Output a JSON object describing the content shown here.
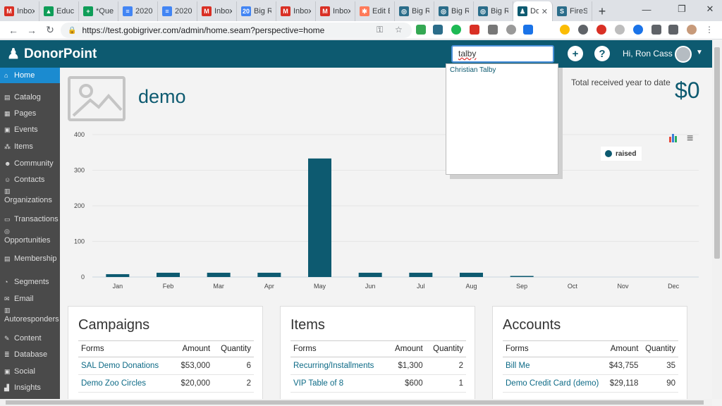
{
  "browser": {
    "tabs": [
      {
        "label": "Inbox",
        "icon": "gmail-icon",
        "color": "#d93025",
        "glyph": "M"
      },
      {
        "label": "Educa",
        "icon": "drive-icon",
        "color": "#0f9d58",
        "glyph": "▲"
      },
      {
        "label": "*Ques",
        "icon": "sheets-icon",
        "color": "#0f9d58",
        "glyph": "+"
      },
      {
        "label": "2020",
        "icon": "docs-icon",
        "color": "#4285f4",
        "glyph": "≡"
      },
      {
        "label": "2020",
        "icon": "docs-icon",
        "color": "#4285f4",
        "glyph": "≡"
      },
      {
        "label": "Inbox",
        "icon": "gmail-icon",
        "color": "#d93025",
        "glyph": "M"
      },
      {
        "label": "Big Ri",
        "icon": "calendar-icon",
        "color": "#4285f4",
        "glyph": "20"
      },
      {
        "label": "Inbox",
        "icon": "gmail-icon",
        "color": "#d93025",
        "glyph": "M"
      },
      {
        "label": "Inbox",
        "icon": "gmail-icon",
        "color": "#d93025",
        "glyph": "M"
      },
      {
        "label": "Edit E",
        "icon": "hubspot-icon",
        "color": "#ff7a59",
        "glyph": "✱"
      },
      {
        "label": "Big Ri",
        "icon": "globe-icon",
        "color": "#2b6d8a",
        "glyph": "◎"
      },
      {
        "label": "Big Ri",
        "icon": "globe-icon",
        "color": "#2b6d8a",
        "glyph": "◎"
      },
      {
        "label": "Big Ri",
        "icon": "globe-icon",
        "color": "#2b6d8a",
        "glyph": "◎"
      },
      {
        "label": "Do",
        "icon": "donorpoint-icon",
        "color": "#0d5a70",
        "glyph": "♟",
        "active": true
      },
      {
        "label": "FireSh",
        "icon": "fireshot-icon",
        "color": "#2b6d8a",
        "glyph": "S"
      }
    ],
    "url": "https://test.gobigriver.com/admin/home.seam?perspective=home"
  },
  "header": {
    "brand": "DonorPoint",
    "search_value": "talby",
    "greeting": "Hi, Ron Cass"
  },
  "search_results": [
    "Christian Talby"
  ],
  "sidebar": {
    "items": [
      {
        "label": "Home",
        "icon": "home-icon",
        "glyph": "⌂",
        "active": true
      },
      {
        "label": "Catalog",
        "icon": "cart-icon",
        "glyph": "▤"
      },
      {
        "label": "Pages",
        "icon": "pages-icon",
        "glyph": "▦"
      },
      {
        "label": "Events",
        "icon": "calendar-icon",
        "glyph": "▣"
      },
      {
        "label": "Items",
        "icon": "items-icon",
        "glyph": "⁂"
      },
      {
        "label": "Community",
        "icon": "users-icon",
        "glyph": "☻"
      },
      {
        "label": "Contacts",
        "icon": "contact-icon",
        "glyph": "☺"
      },
      {
        "label": "Organizations",
        "icon": "building-icon",
        "glyph": "▥"
      },
      {
        "label": "Transactions",
        "icon": "money-icon",
        "glyph": "▭"
      },
      {
        "label": "Opportunities",
        "icon": "target-icon",
        "glyph": "◎"
      },
      {
        "label": "Membership",
        "icon": "id-card-icon",
        "glyph": "▤"
      },
      {
        "label": "Segments",
        "icon": "segments-icon",
        "glyph": "◔"
      },
      {
        "label": "Email",
        "icon": "envelope-icon",
        "glyph": "✉"
      },
      {
        "label": "Autoresponders",
        "icon": "book-icon",
        "glyph": "▥"
      },
      {
        "label": "Content",
        "icon": "content-icon",
        "glyph": "✎"
      },
      {
        "label": "Database",
        "icon": "database-icon",
        "glyph": "≣"
      },
      {
        "label": "Social",
        "icon": "social-icon",
        "glyph": "▣"
      },
      {
        "label": "Insights",
        "icon": "chart-icon",
        "glyph": "▟"
      }
    ]
  },
  "main": {
    "title": "demo",
    "total_label": "Total received year to date",
    "total_value": "$0"
  },
  "chart_data": {
    "type": "bar",
    "categories": [
      "Jan",
      "Feb",
      "Mar",
      "Apr",
      "May",
      "Jun",
      "Jul",
      "Aug",
      "Sep",
      "Oct",
      "Nov",
      "Dec"
    ],
    "series": [
      {
        "name": "raised",
        "values": [
          8,
          12,
          12,
          12,
          333,
          12,
          12,
          12,
          3,
          0,
          0,
          0
        ]
      }
    ],
    "yticks": [
      0,
      100,
      200,
      300,
      400
    ],
    "ylim": [
      0,
      400
    ],
    "legend": "top-right",
    "grid": true,
    "color": "#0d5a70"
  },
  "cards": [
    {
      "title": "Campaigns",
      "headers": [
        "Forms",
        "Amount",
        "Quantity"
      ],
      "rows": [
        [
          "SAL Demo Donations",
          "$53,000",
          "6"
        ],
        [
          "Demo Zoo Circles",
          "$20,000",
          "2"
        ]
      ]
    },
    {
      "title": "Items",
      "headers": [
        "Forms",
        "Amount",
        "Quantity"
      ],
      "rows": [
        [
          "Recurring/Installments",
          "$1,300",
          "2"
        ],
        [
          "VIP Table of 8",
          "$600",
          "1"
        ]
      ]
    },
    {
      "title": "Accounts",
      "headers": [
        "Forms",
        "Amount",
        "Quantity"
      ],
      "rows": [
        [
          "Bill Me",
          "$43,755",
          "35"
        ],
        [
          "Demo Credit Card (demo)",
          "$29,118",
          "90"
        ]
      ]
    }
  ]
}
